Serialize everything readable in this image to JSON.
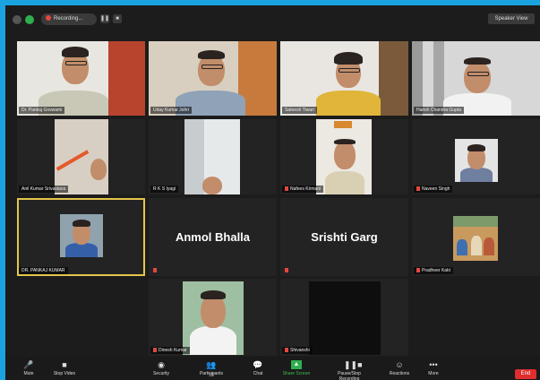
{
  "topbar": {
    "recording_label": "Recording...",
    "speaker_view_label": "Speaker View"
  },
  "participants": [
    "Dr. Pankaj Goswami",
    "Uday Kumar Johri",
    "Sateesh Tiwari",
    "Harish Chandra Gupta",
    "Anil Kumar Srivastava",
    "R K S Iyagi",
    "Nafees Kirmani",
    "Naveen Singh",
    "DR. PANKAJ KUMAR",
    "Anmol Bhalla",
    "Srishti Garg",
    "Pradheer Kakt",
    "Dinesh Kumar",
    "Shivanshi"
  ],
  "toolbar": {
    "mute": "Mute",
    "video": "Stop Video",
    "security": "Security",
    "participants": "Participants",
    "participants_count": "16",
    "chat": "Chat",
    "share": "Share Screen",
    "record": "Pause/Stop Recording",
    "reactions": "Reactions",
    "more": "More",
    "end": "End"
  }
}
